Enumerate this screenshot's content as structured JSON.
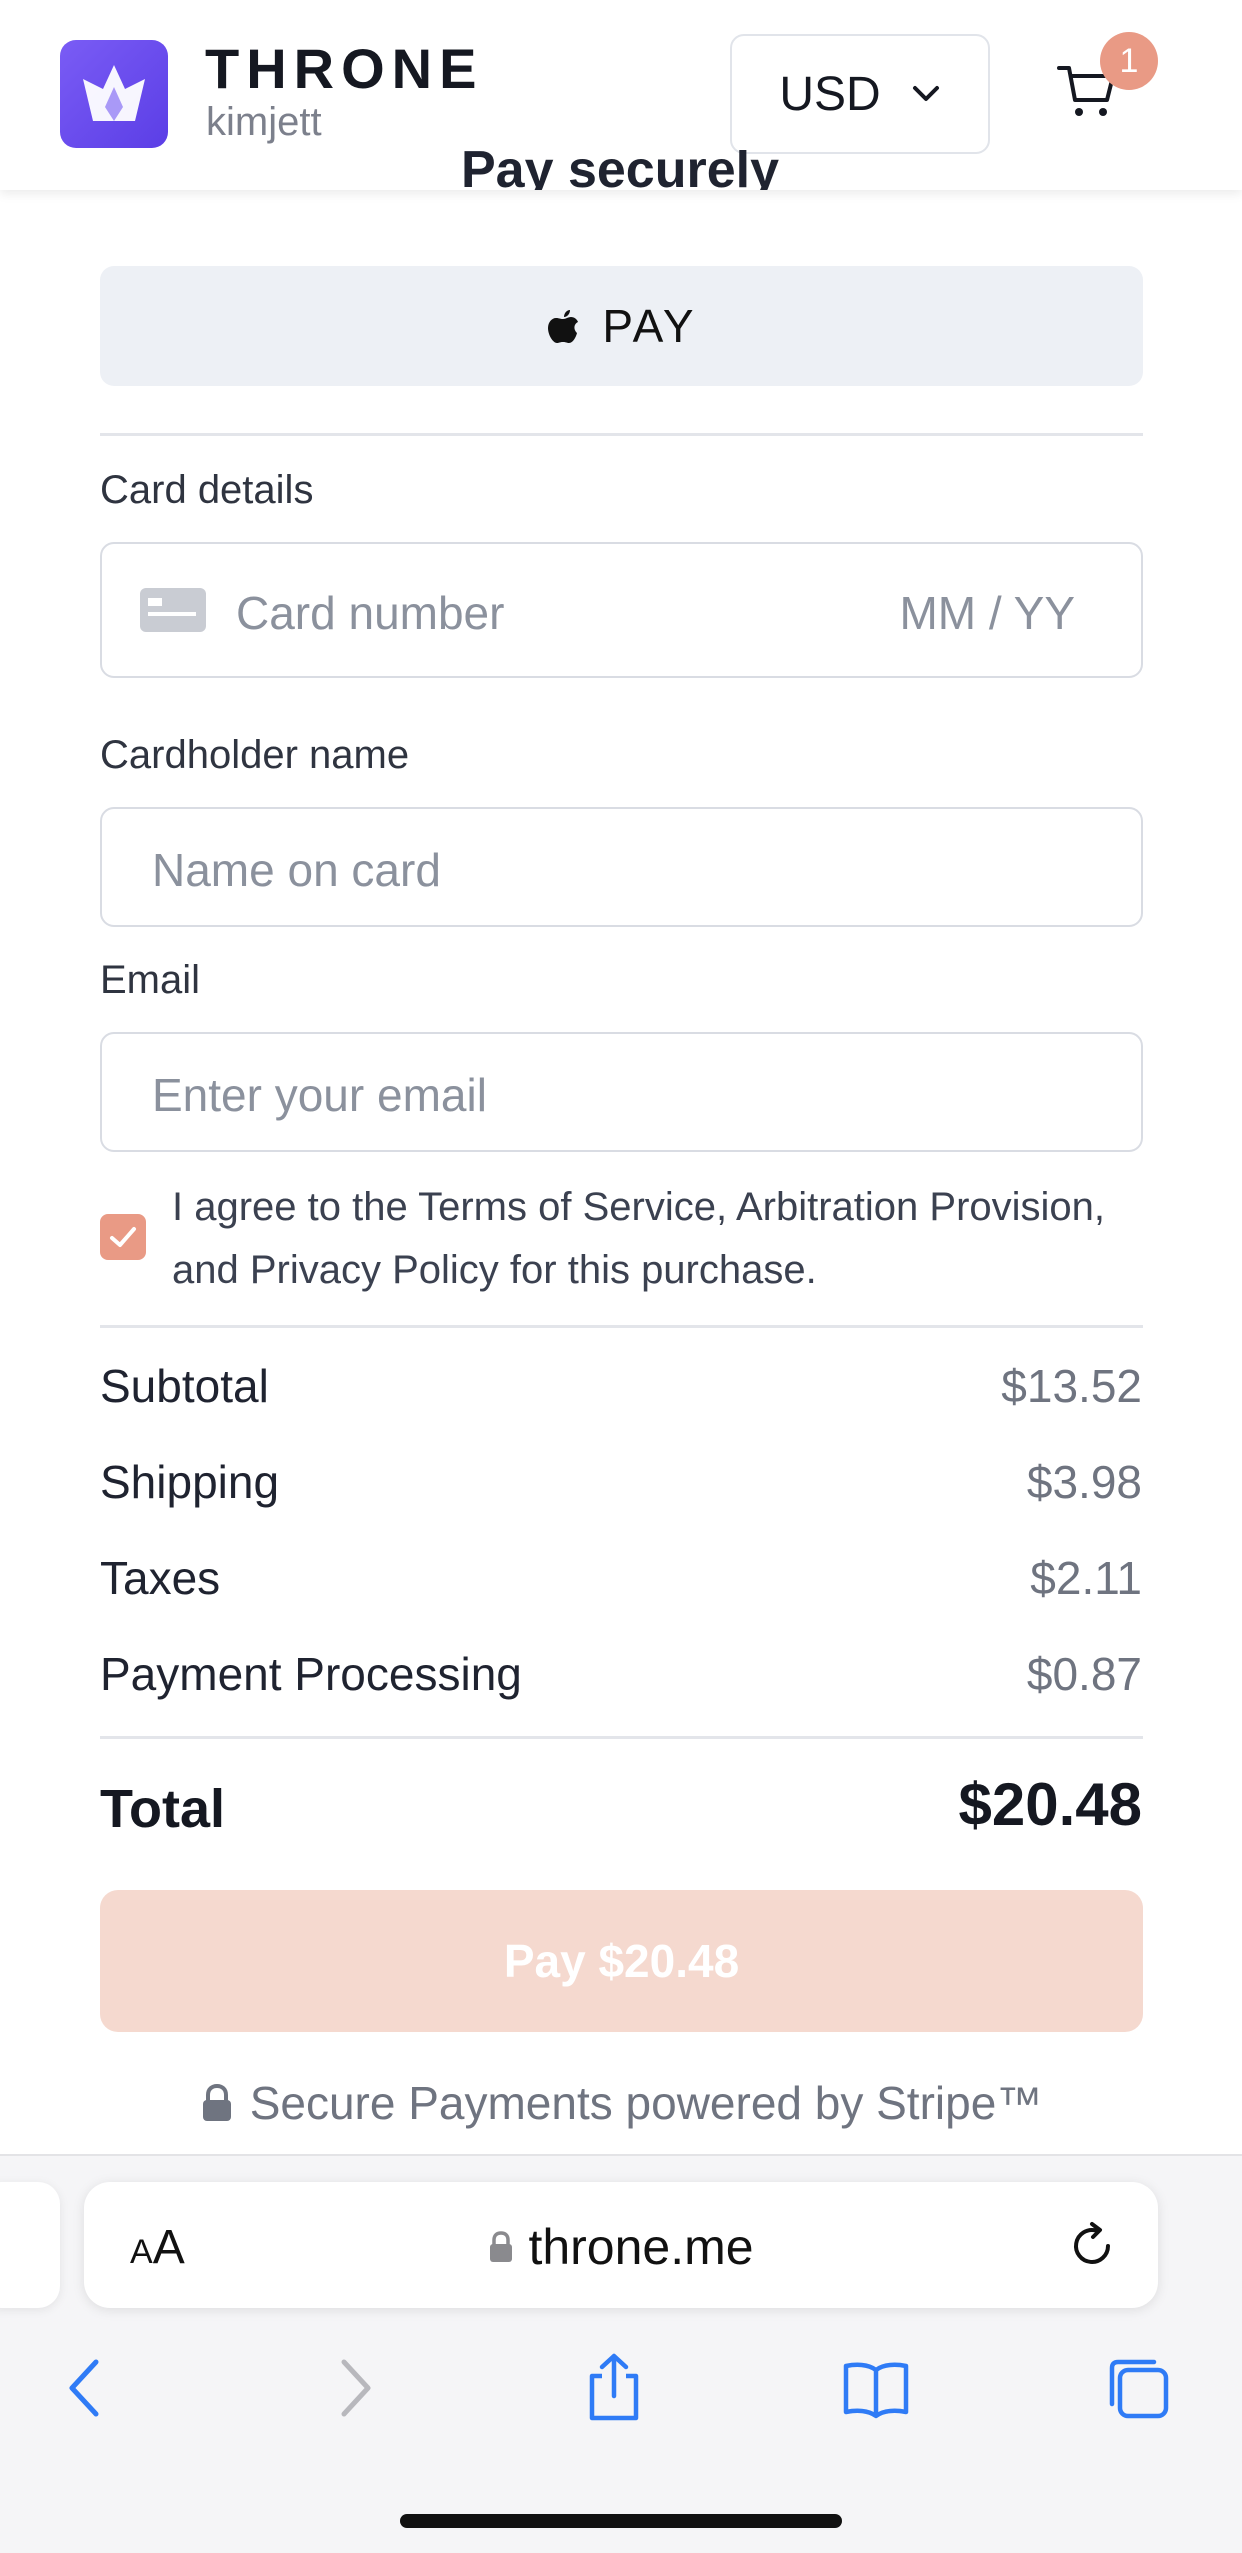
{
  "header": {
    "brand": "THRONE",
    "username": "kimjett",
    "currency": "USD",
    "cart_count": "1"
  },
  "page": {
    "clipped_title": "Pay securely"
  },
  "payment": {
    "apple_pay_label": "PAY",
    "card_details_label": "Card details",
    "card_number_placeholder": "Card number",
    "expiry_placeholder": "MM / YY",
    "cardholder_label": "Cardholder name",
    "cardholder_placeholder": "Name on card",
    "email_label": "Email",
    "email_placeholder": "Enter your email",
    "agree_checked": true,
    "agree_text": "I agree to the Terms of Service, Arbitration Provision, and Privacy Policy for this purchase."
  },
  "summary": {
    "rows": [
      {
        "label": "Subtotal",
        "value": "$13.52"
      },
      {
        "label": "Shipping",
        "value": "$3.98"
      },
      {
        "label": "Taxes",
        "value": "$2.11"
      },
      {
        "label": "Payment Processing",
        "value": "$0.87"
      }
    ],
    "total_label": "Total",
    "total_value": "$20.48",
    "pay_button": "Pay $20.48",
    "secure_text": "Secure Payments powered by Stripe™"
  },
  "browser": {
    "aa_label_small": "A",
    "aa_label_big": "A",
    "url": "throne.me"
  },
  "colors": {
    "accent": "#e99a85",
    "pay_button_disabled": "#f5d9cf",
    "logo": "#6a4cf0",
    "ios_blue": "#2f7bf6"
  }
}
